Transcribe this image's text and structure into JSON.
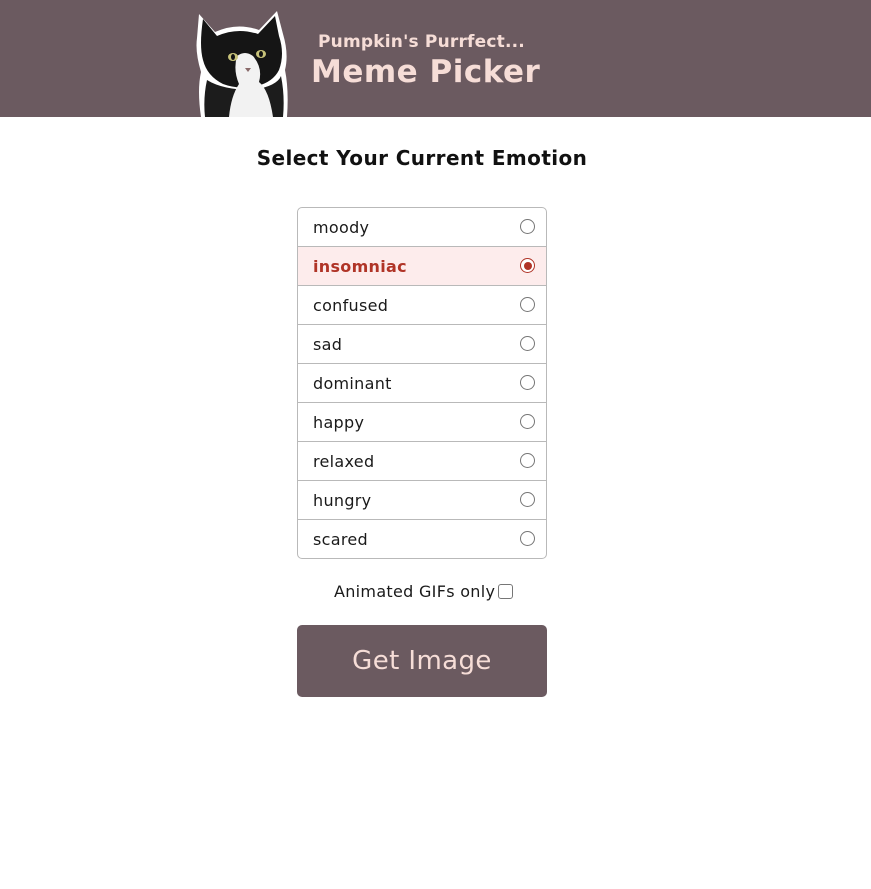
{
  "header": {
    "subtitle": "Pumpkin's Purrfect...",
    "title": "Meme Picker",
    "logo_icon": "cat-photo-icon"
  },
  "main": {
    "heading": "Select Your Current Emotion",
    "emotions": [
      {
        "label": "moody",
        "selected": false
      },
      {
        "label": "insomniac",
        "selected": true
      },
      {
        "label": "confused",
        "selected": false
      },
      {
        "label": "sad",
        "selected": false
      },
      {
        "label": "dominant",
        "selected": false
      },
      {
        "label": "happy",
        "selected": false
      },
      {
        "label": "relaxed",
        "selected": false
      },
      {
        "label": "hungry",
        "selected": false
      },
      {
        "label": "scared",
        "selected": false
      }
    ],
    "gif_option": {
      "label": "Animated GIFs only",
      "checked": false
    },
    "button_label": "Get Image"
  },
  "colors": {
    "header_bg": "#6b5a60",
    "header_text": "#f6ddd7",
    "selected_bg": "#fdecec",
    "selected_text": "#b03427"
  }
}
